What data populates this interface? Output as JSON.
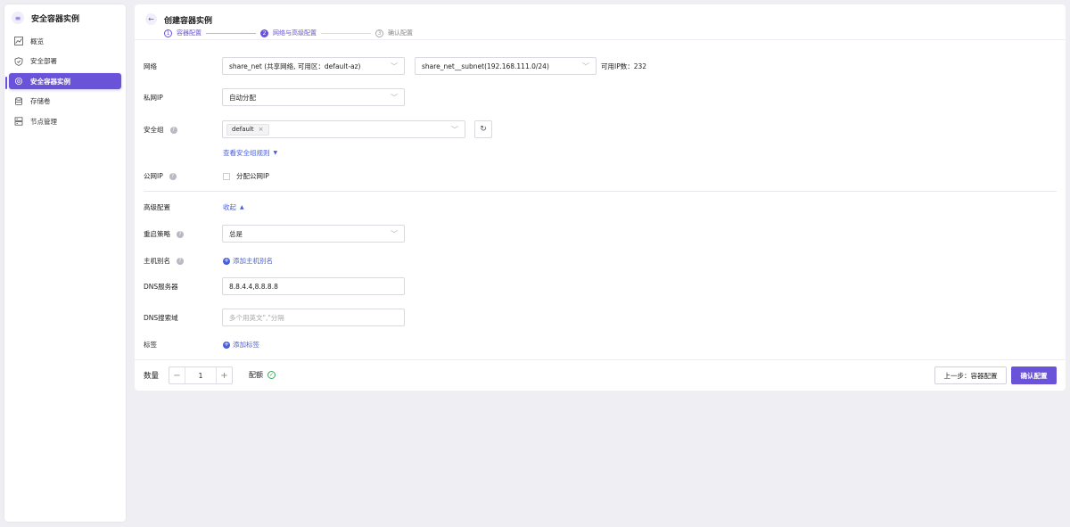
{
  "sidebar": {
    "title": "安全容器实例",
    "logo_icon": "menu-icon",
    "items": [
      {
        "label": "概览",
        "icon": "chart-icon"
      },
      {
        "label": "安全部署",
        "icon": "shield-icon"
      },
      {
        "label": "安全容器实例",
        "icon": "gear-icon"
      },
      {
        "label": "存储卷",
        "icon": "database-icon"
      },
      {
        "label": "节点管理",
        "icon": "server-icon"
      }
    ]
  },
  "header": {
    "title": "创建容器实例",
    "steps": [
      {
        "num": "1",
        "label": "容器配置"
      },
      {
        "num": "2",
        "label": "网络与高级配置"
      },
      {
        "num": "3",
        "label": "确认配置"
      }
    ]
  },
  "form": {
    "network": {
      "label": "网络",
      "vpc_value": "share_net (共享网络, 可用区：default-az)",
      "subnet_value": "share_net__subnet(192.168.111.0/24)",
      "ip_count": "可用IP数：232"
    },
    "private_ip": {
      "label": "私网IP",
      "value": "自动分配"
    },
    "security_group": {
      "label": "安全组",
      "tag": "default",
      "view_rules": "查看安全组规则"
    },
    "public_ip": {
      "label": "公网IP",
      "checkbox_label": "分配公网IP"
    },
    "advanced": {
      "label": "高级配置",
      "toggle": "收起"
    },
    "restart_policy": {
      "label": "重启策略",
      "value": "总是"
    },
    "host_alias": {
      "label": "主机别名",
      "add": "添加主机别名"
    },
    "dns_server": {
      "label": "DNS服务器",
      "value": "8.8.4.4,8.8.8.8"
    },
    "dns_search": {
      "label": "DNS搜索域",
      "placeholder": "多个用英文\",\"分隔"
    },
    "labels": {
      "label": "标签",
      "add": "添加标签"
    }
  },
  "footer": {
    "quantity_label": "数量",
    "quantity": "1",
    "quota_label": "配额",
    "prev_button": "上一步：容器配置",
    "confirm_button": "确认配置"
  },
  "colors": {
    "accent": "#6a52d9",
    "link": "#4a5fd6",
    "ok": "#3aa757"
  }
}
